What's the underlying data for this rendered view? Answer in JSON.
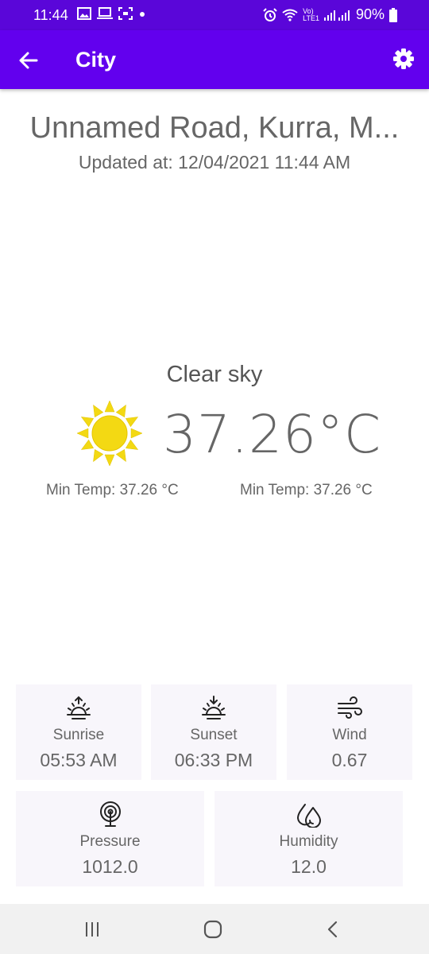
{
  "status_bar": {
    "time": "11:44",
    "battery_text": "90%",
    "network_label_top": "Vo)",
    "network_label_bottom": "LTE1",
    "icons": [
      "gallery-icon",
      "laptop-icon",
      "screenshot-icon",
      "dot-icon",
      "alarm-icon",
      "wifi-icon",
      "signal-icon",
      "battery-icon"
    ]
  },
  "app_bar": {
    "title": "City",
    "back_icon": "arrow-left-icon",
    "settings_icon": "gear-icon",
    "color": "#6200ee"
  },
  "weather": {
    "location": "Unnamed Road, Kurra, M...",
    "updated_at": "Updated at: 12/04/2021 11:44 AM",
    "condition": "Clear sky",
    "temperature": "37.26°C",
    "min_temp_left": "Min Temp: 37.26 °C",
    "min_temp_right": "Min Temp: 37.26 °C",
    "condition_icon": "sun-icon"
  },
  "details": {
    "sunrise": {
      "label": "Sunrise",
      "value": "05:53 AM",
      "icon": "sunrise-icon"
    },
    "sunset": {
      "label": "Sunset",
      "value": "06:33 PM",
      "icon": "sunset-icon"
    },
    "wind": {
      "label": "Wind",
      "value": "0.67",
      "icon": "wind-icon"
    },
    "pressure": {
      "label": "Pressure",
      "value": "1012.0",
      "icon": "pressure-icon"
    },
    "humidity": {
      "label": "Humidity",
      "value": "12.0",
      "icon": "humidity-icon"
    }
  },
  "nav_bar": {
    "icons": [
      "recents-icon",
      "home-icon",
      "back-icon"
    ]
  }
}
